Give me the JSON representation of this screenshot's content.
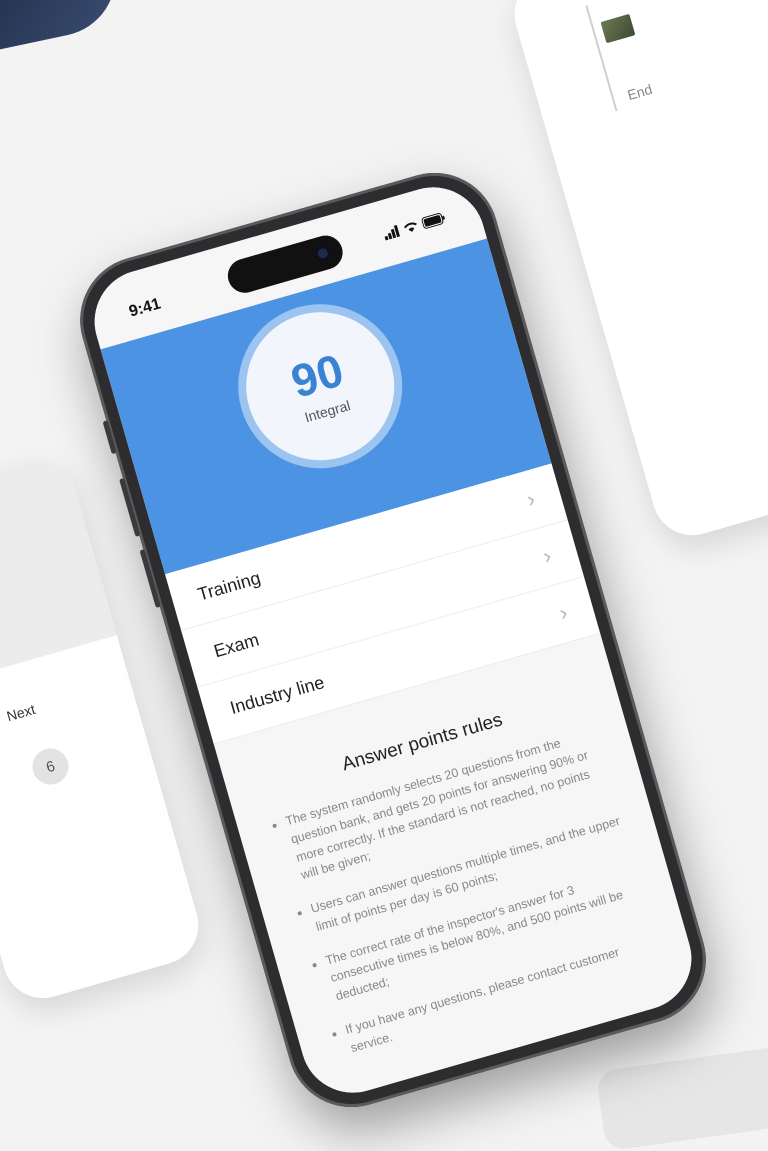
{
  "status_bar": {
    "time": "9:41"
  },
  "score": {
    "value": "90",
    "label": "Integral"
  },
  "menu": [
    {
      "label": "Training"
    },
    {
      "label": "Exam"
    },
    {
      "label": "Industry line"
    }
  ],
  "rules": {
    "title": "Answer points rules",
    "items": [
      "The system randomly selects 20 questions from the question bank, and gets 20 points for answering 90% or more correctly. If the standard is not reached, no points will be given;",
      "Users can answer questions multiple times, and the upper limit of points per day is 60 points;",
      "The correct rate of the inspector's answer for 3 consecutive times is below 80%, and 500 points will be deducted;",
      "If you have any questions, please contact customer service."
    ]
  },
  "background": {
    "left_card": {
      "next_label": "Next",
      "number": "6"
    },
    "right_card": {
      "end_label": "End"
    }
  },
  "colors": {
    "header_blue": "#4c94e3",
    "score_blue": "#3a82d4",
    "check_green": "#39b84a"
  }
}
